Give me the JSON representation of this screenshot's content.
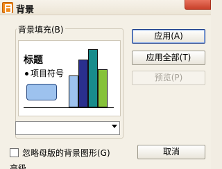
{
  "window": {
    "title": "背景"
  },
  "fill_group": {
    "label": "背景填充(B)"
  },
  "preview": {
    "title": "标题",
    "bullet": "项目符号",
    "bars": [
      {
        "value": 0.55,
        "color": "#9dc2ee"
      },
      {
        "value": 0.82,
        "color": "#2a2f8e"
      },
      {
        "value": 1.0,
        "color": "#188c8c"
      },
      {
        "value": 0.66,
        "color": "#86c23a"
      }
    ]
  },
  "fill_select": {
    "value": ""
  },
  "buttons": {
    "apply": "应用(A)",
    "apply_all": "应用全部(T)",
    "preview": "预览(P)",
    "cancel": "取消"
  },
  "checkbox": {
    "label": "忽略母版的背景图形(G)",
    "checked": false
  },
  "bottom_cut_text": "高级"
}
